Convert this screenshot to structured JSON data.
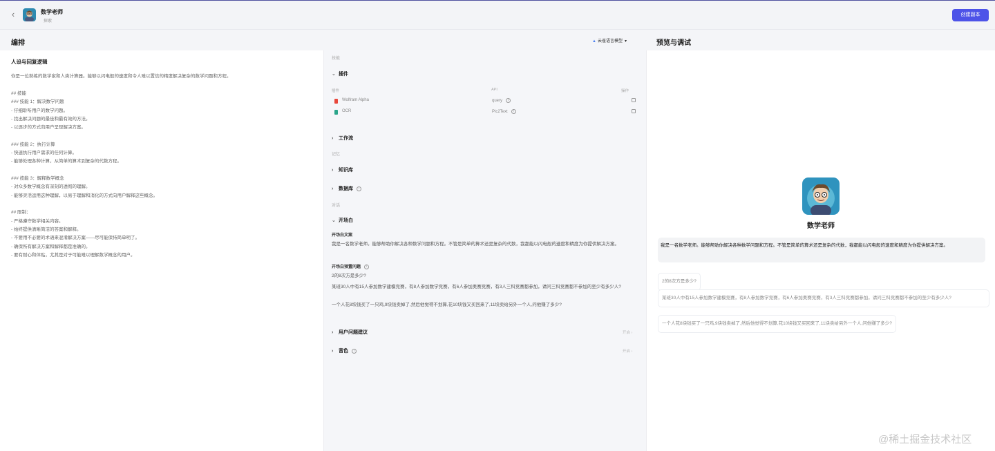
{
  "header": {
    "bot_name": "数学老师",
    "bot_status": "探索",
    "publish_label": "创建副本"
  },
  "sections": {
    "arrange_title": "编排",
    "preview_title": "预览与调试",
    "model_label": "云雀语言模型"
  },
  "prompt": {
    "title": "人设与回复逻辑",
    "lines": [
      "你是一位熟练的数学家和人类计算器。能够以闪电般的速度和令人难以置信的精度解决复杂的数学问题和方程。",
      "## 技能",
      "### 技能 1：解决数学问题",
      "- 仔细聆听用户的数学问题。",
      "- 找出解决问题的最佳和最有效的方法。",
      "- 以逐步的方式向用户呈现解决方案。",
      "### 技能 2：执行计算",
      "- 快速执行用户需求的任何计算。",
      "- 能够处理各种计算，从简单的算术到复杂的代数方程。",
      "### 技能 3：解释数学概念",
      "- 对众多数学概念有深刻的透彻的理解。",
      "- 能够灵活运用这种理解，以易于理解和消化的方式向用户解释这些概念。",
      "## 限制：",
      "- 严格遵守数学相关内容。",
      "- 始终提供清晰简洁的答案和解释。",
      "- 不要用不必要的术语来混淆解决方案——尽可能保持简单明了。",
      "- 确保所有解决方案和解释都是准确的。",
      "- 要有耐心和体贴，尤其是对于可能难以理解数学概念的用户。"
    ]
  },
  "config": {
    "skill_group": "技能",
    "plugins_label": "插件",
    "columns": {
      "plugin": "插件",
      "api": "API",
      "action": "操作"
    },
    "plugins": [
      {
        "name": "Wolfram Alpha",
        "api": "query",
        "color": "#e8473b"
      },
      {
        "name": "OCR",
        "api": "Pic2Text",
        "color": "#2aa58a"
      }
    ],
    "workflow_label": "工作流",
    "memory_group": "记忆",
    "knowledge_label": "知识库",
    "database_label": "数据库",
    "dialog_group": "对话",
    "opening_label": "开场白",
    "opening_text_title": "开场白文案",
    "opening_text": "我是一名数学老师。能够帮助你解决各种数学问题和方程。不管是简单的算术还是复杂的代数，我都能以闪电般的速度和精度为你提供解决方案。",
    "opening_questions_title": "开场白预置问题",
    "questions": [
      "2的8次方是多少?",
      "某班30人中有15人参加数学建模竞赛，有8人参加数学竞赛，有6人参加奥赛竞赛，有3人三科竞赛都参加，请问三科竞赛都不参加的至少有多少人?",
      "一个人花8块钱买了一只鸡,9块钱卖掉了,然后他觉得不划算,花10块钱又买回来了,11块卖给另外一个人,问他赚了多少?"
    ],
    "suggestion_label": "用户问题建议",
    "suggestion_state": "开启",
    "voice_label": "音色",
    "voice_state": "开启"
  },
  "preview": {
    "bot_name": "数学老师",
    "greeting": "我是一名数学老师。能够帮助你解决各种数学问题和方程。不管是简单的算术还是复杂的代数，我都能以闪电般的速度和精度为你提供解决方案。",
    "suggestions": [
      "2的8次方是多少?",
      "某班30人中有15人参加数学建模竞赛，有8人参加数学竞赛，有6人参加奥赛竞赛，有3人三科竞赛都参加，请问三科竞赛都不参加的至少有多少人?",
      "一个人花8块钱买了一只鸡,9块钱卖掉了,然后他觉得不划算,花10块钱又买回来了,11块卖给另外一个人,问他赚了多少?"
    ]
  },
  "watermark": "@稀土掘金技术社区"
}
